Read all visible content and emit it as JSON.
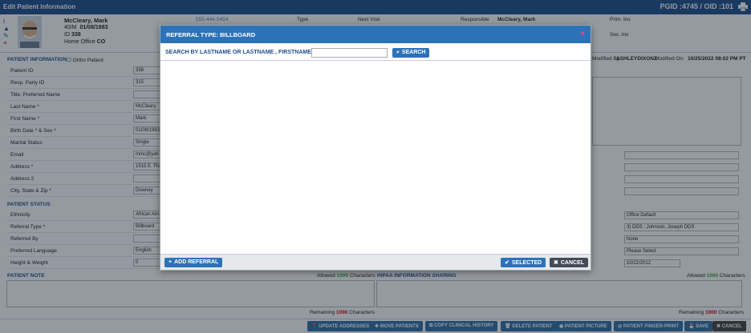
{
  "window": {
    "title": "Edit Patient Information",
    "ids": "PGID :4745  /  OID :101"
  },
  "header": {
    "name": "McCleary, Mark",
    "age_sex": "40/M",
    "dob": "01/08/1983",
    "id_label": "ID",
    "id": "338",
    "home_office_label": "Home Office",
    "home_office": "CO",
    "phone": "555-444-5454",
    "type_label": "Type",
    "next_visit_label": "Next Visit",
    "responsible_label": "Responsible",
    "responsible": "McCleary, Mark",
    "prim_ins": "Prim. Ins",
    "sec_ins": "Sec. Ins",
    "modified_by_label": "Modified By:",
    "modified_by": "ASHLEYDIXONZ",
    "modified_on_label": "Modified On:",
    "modified_on": "10/25/2022 08:02 PM PT"
  },
  "patient_info": {
    "title": "PATIENT INFORMATION",
    "ortho_label": "Ortho Patient",
    "rows": [
      {
        "label": "Patient ID",
        "value": "338"
      },
      {
        "label": "Resp. Party ID",
        "value": "315"
      },
      {
        "label": "Title, Preferred Name",
        "value": ""
      },
      {
        "label": "Last Name *",
        "value": "McCleary"
      },
      {
        "label": "First Name *",
        "value": "Mark"
      },
      {
        "label": "Birth Date * & Sex *",
        "value": "01/08/1983"
      },
      {
        "label": "Marital Status",
        "value": "Single"
      },
      {
        "label": "Email",
        "value": "mmc@yah"
      },
      {
        "label": "Address *",
        "value": "1515 E. Flor"
      },
      {
        "label": "Address 2",
        "value": ""
      },
      {
        "label": "City, State & Zip *",
        "value": "Downey"
      }
    ]
  },
  "patient_status": {
    "title": "PATIENT STATUS",
    "rows": [
      {
        "label": "Ethnicity",
        "value": "African Am"
      },
      {
        "label": "Referral Type *",
        "value": "Billboard"
      },
      {
        "label": "Referred By",
        "value": ""
      },
      {
        "label": "Preferred Language",
        "value": "English"
      },
      {
        "label": "Height & Weight",
        "value": "0"
      }
    ],
    "right_fields": [
      "Office Default",
      "3) DDS : Johnson, Joseph DDS",
      "None",
      "Please Select",
      "10/22/2012"
    ]
  },
  "notes": {
    "patient_note_title": "PATIENT NOTE",
    "hipaa_title": "HIPAA INFORMATION SHARING",
    "allowed_prefix": "Allowed",
    "allowed_count": "1000",
    "allowed_suffix": "Characters",
    "remaining_prefix": "Remaining",
    "remaining_count": "1000",
    "remaining_suffix": "Characters"
  },
  "footer": {
    "buttons": [
      "UPDATE ADDRESSES",
      "MOVE PATIENTS",
      "COPY CLINICAL HISTORY",
      "DELETE PATIENT",
      "PATIENT PICTURE",
      "PATIENT FINGER-PRINT",
      "SAVE",
      "CANCEL"
    ]
  },
  "modal": {
    "title": "REFERRAL TYPE: BILLBOARD",
    "close": "×",
    "search_label": "SEARCH BY LASTNAME OR LASTNAME , FIRSTNAME",
    "search_value": "",
    "search_button": "SEARCH",
    "add_button": "ADD REFERRAL",
    "selected_button": "SELECTED",
    "cancel_button": "CANCEL"
  },
  "colors": {
    "accent": "#2c72b9",
    "titlebar": "#1e4f8c",
    "required": "#cc0000"
  }
}
